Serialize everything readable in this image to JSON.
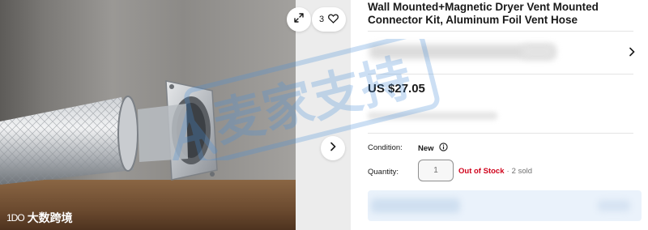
{
  "gallery": {
    "watch_count": "3",
    "icons": {
      "expand": "expand-arrows-icon",
      "watch": "heart-icon",
      "next": "chevron-right-icon"
    },
    "logo_text": "大数跨境",
    "logo_mark": "1DO"
  },
  "listing": {
    "title": "Wall Mounted+Magnetic Dryer Vent Mounted Connector Kit, Aluminum Foil Vent Hose",
    "price": "US $27.05"
  },
  "details": {
    "condition_label": "Condition:",
    "condition_value": "New",
    "quantity_label": "Quantity:",
    "quantity_value": "1",
    "stock_status": "Out of Stock",
    "separator": "·",
    "sold_count": "2 sold"
  },
  "watermark": {
    "text": "麦家支持"
  },
  "colors": {
    "out_of_stock": "#d0021b",
    "buy_area": "#eaf2fb",
    "watermark": "#4a90d9"
  }
}
